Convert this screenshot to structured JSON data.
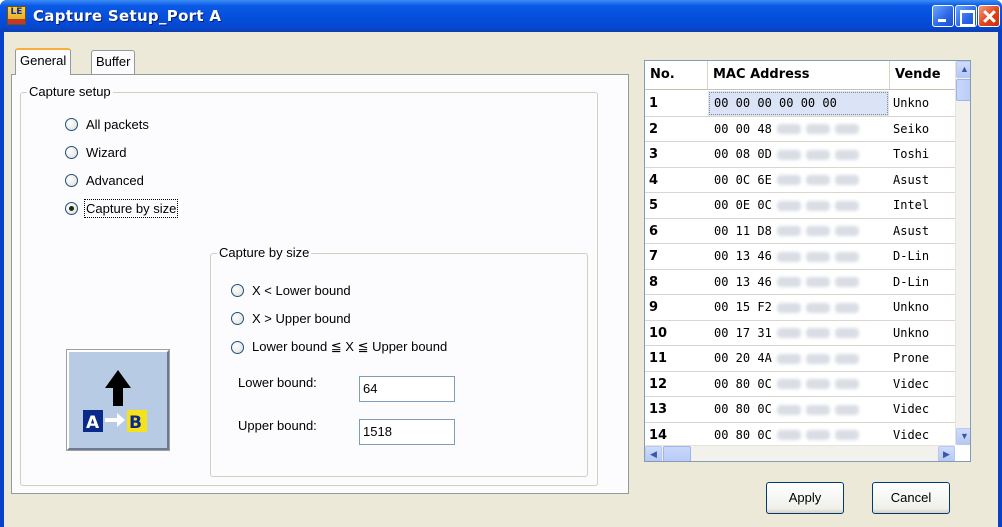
{
  "window": {
    "title": "Capture Setup_Port A",
    "app_icon_text": "LE"
  },
  "tabs": [
    {
      "label": "General",
      "active": true
    },
    {
      "label": "Buffer",
      "active": false
    }
  ],
  "capture_setup": {
    "legend": "Capture setup",
    "options": [
      {
        "label": "All packets",
        "checked": false
      },
      {
        "label": "Wizard",
        "checked": false
      },
      {
        "label": "Advanced",
        "checked": false
      },
      {
        "label": "Capture by size",
        "checked": true
      }
    ]
  },
  "capture_by_size": {
    "legend": "Capture by size",
    "options": [
      {
        "label": "X < Lower bound",
        "checked": false
      },
      {
        "label": "X > Upper bound",
        "checked": false
      },
      {
        "label": "Lower bound ≦ X ≦ Upper bound",
        "checked": false
      }
    ],
    "lower_bound_label": "Lower bound:",
    "lower_bound_value": "64",
    "upper_bound_label": "Upper bound:",
    "upper_bound_value": "1518"
  },
  "mac_table": {
    "columns": [
      "No.",
      "MAC Address",
      "Vende"
    ],
    "rows": [
      {
        "no": "1",
        "mac": "00 00 00 00 00 00",
        "vendor": "Unkno",
        "blurred": false,
        "selected": true
      },
      {
        "no": "2",
        "mac": "00 00 48",
        "vendor": "Seiko",
        "blurred": true
      },
      {
        "no": "3",
        "mac": "00 08 0D",
        "vendor": "Toshi",
        "blurred": true
      },
      {
        "no": "4",
        "mac": "00 0C 6E",
        "vendor": "Asust",
        "blurred": true
      },
      {
        "no": "5",
        "mac": "00 0E 0C",
        "vendor": "Intel",
        "blurred": true
      },
      {
        "no": "6",
        "mac": "00 11 D8",
        "vendor": "Asust",
        "blurred": true
      },
      {
        "no": "7",
        "mac": "00 13 46",
        "vendor": "D-Lin",
        "blurred": true
      },
      {
        "no": "8",
        "mac": "00 13 46",
        "vendor": "D-Lin",
        "blurred": true
      },
      {
        "no": "9",
        "mac": "00 15 F2",
        "vendor": "Unkno",
        "blurred": true
      },
      {
        "no": "10",
        "mac": "00 17 31",
        "vendor": "Unkno",
        "blurred": true
      },
      {
        "no": "11",
        "mac": "00 20 4A",
        "vendor": "Prone",
        "blurred": true
      },
      {
        "no": "12",
        "mac": "00 80 0C",
        "vendor": "Videc",
        "blurred": true
      },
      {
        "no": "13",
        "mac": "00 80 0C",
        "vendor": "Videc",
        "blurred": true
      },
      {
        "no": "14",
        "mac": "00 80 0C",
        "vendor": "Videc",
        "blurred": true
      }
    ]
  },
  "buttons": {
    "apply": "Apply",
    "cancel": "Cancel"
  },
  "icons": {
    "app": "le-app-icon",
    "capture_size": "a-to-b-arrow-icon",
    "minimize": "minimize-icon",
    "maximize": "maximize-icon",
    "close": "close-icon"
  }
}
